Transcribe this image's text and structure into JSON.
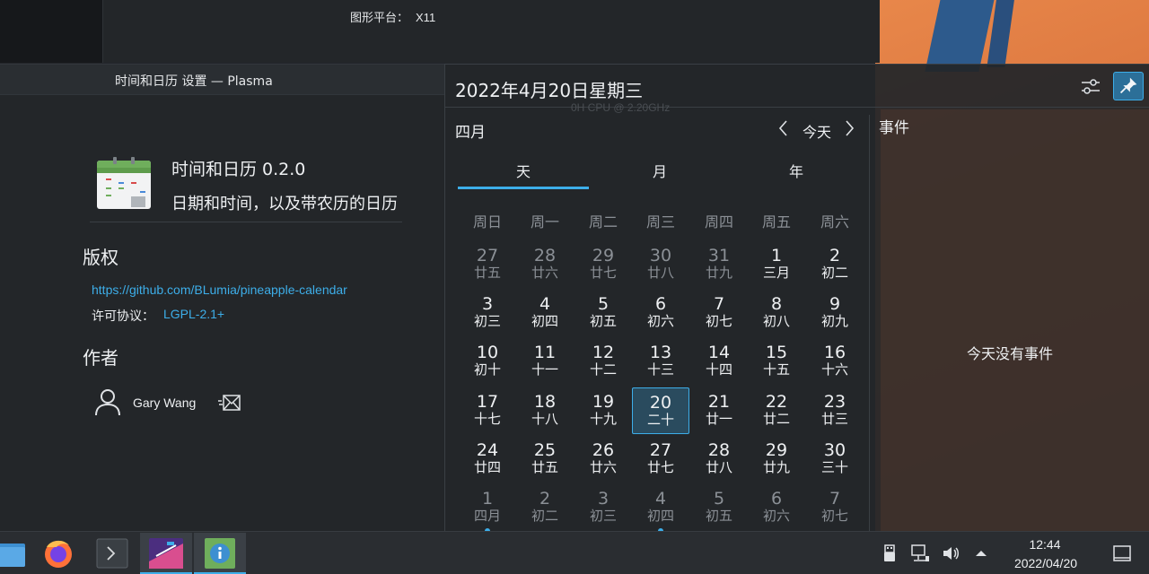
{
  "background": {
    "platform_label": "图形平台：",
    "platform_value": "X11",
    "cpu_text": "0H CPU @ 2.20GHz"
  },
  "settings_window": {
    "title": "时间和日历 设置 — Plasma",
    "app_name": "时间和日历 0.2.0",
    "app_description": "日期和时间，以及带农历的日历",
    "copyright_heading": "版权",
    "repo_url": "https://github.com/BLumia/pineapple-calendar",
    "license_label": "许可协议：",
    "license_value": "LGPL-2.1+",
    "authors_heading": "作者",
    "author_name": "Gary Wang"
  },
  "calendar": {
    "header_date": "2022年4月20日星期三",
    "month_label": "四月",
    "today_button": "今天",
    "tabs": [
      "天",
      "月",
      "年"
    ],
    "active_tab": 0,
    "weekdays": [
      "周日",
      "周一",
      "周二",
      "周三",
      "周四",
      "周五",
      "周六"
    ],
    "days": [
      {
        "num": "27",
        "lunar": "廿五",
        "other": true
      },
      {
        "num": "28",
        "lunar": "廿六",
        "other": true
      },
      {
        "num": "29",
        "lunar": "廿七",
        "other": true
      },
      {
        "num": "30",
        "lunar": "廿八",
        "other": true
      },
      {
        "num": "31",
        "lunar": "廿九",
        "other": true
      },
      {
        "num": "1",
        "lunar": "三月"
      },
      {
        "num": "2",
        "lunar": "初二"
      },
      {
        "num": "3",
        "lunar": "初三"
      },
      {
        "num": "4",
        "lunar": "初四"
      },
      {
        "num": "5",
        "lunar": "初五"
      },
      {
        "num": "6",
        "lunar": "初六"
      },
      {
        "num": "7",
        "lunar": "初七"
      },
      {
        "num": "8",
        "lunar": "初八"
      },
      {
        "num": "9",
        "lunar": "初九"
      },
      {
        "num": "10",
        "lunar": "初十"
      },
      {
        "num": "11",
        "lunar": "十一"
      },
      {
        "num": "12",
        "lunar": "十二"
      },
      {
        "num": "13",
        "lunar": "十三"
      },
      {
        "num": "14",
        "lunar": "十四"
      },
      {
        "num": "15",
        "lunar": "十五"
      },
      {
        "num": "16",
        "lunar": "十六"
      },
      {
        "num": "17",
        "lunar": "十七"
      },
      {
        "num": "18",
        "lunar": "十八"
      },
      {
        "num": "19",
        "lunar": "十九"
      },
      {
        "num": "20",
        "lunar": "二十",
        "today": true
      },
      {
        "num": "21",
        "lunar": "廿一"
      },
      {
        "num": "22",
        "lunar": "廿二"
      },
      {
        "num": "23",
        "lunar": "廿三"
      },
      {
        "num": "24",
        "lunar": "廿四"
      },
      {
        "num": "25",
        "lunar": "廿五"
      },
      {
        "num": "26",
        "lunar": "廿六"
      },
      {
        "num": "27",
        "lunar": "廿七"
      },
      {
        "num": "28",
        "lunar": "廿八"
      },
      {
        "num": "29",
        "lunar": "廿九"
      },
      {
        "num": "30",
        "lunar": "三十"
      },
      {
        "num": "1",
        "lunar": "四月",
        "other": true,
        "event": true
      },
      {
        "num": "2",
        "lunar": "初二",
        "other": true
      },
      {
        "num": "3",
        "lunar": "初三",
        "other": true
      },
      {
        "num": "4",
        "lunar": "初四",
        "other": true,
        "event": true
      },
      {
        "num": "5",
        "lunar": "初五",
        "other": true
      },
      {
        "num": "6",
        "lunar": "初六",
        "other": true
      },
      {
        "num": "7",
        "lunar": "初七",
        "other": true
      }
    ],
    "events_heading": "事件",
    "no_events": "今天没有事件"
  },
  "taskbar": {
    "apps": [
      "file-manager",
      "firefox",
      "terminal",
      "plasma-settings",
      "about-system"
    ],
    "active_apps": [
      "plasma-settings",
      "about-system"
    ],
    "tray_icons": [
      "usb-icon",
      "network-icon",
      "volume-icon",
      "tray-expand-icon"
    ],
    "clock_time": "12:44",
    "clock_date": "2022/04/20"
  },
  "colors": {
    "accent": "#3daee9",
    "panel": "#232629",
    "wallpaper_orange": "#e8874a"
  }
}
